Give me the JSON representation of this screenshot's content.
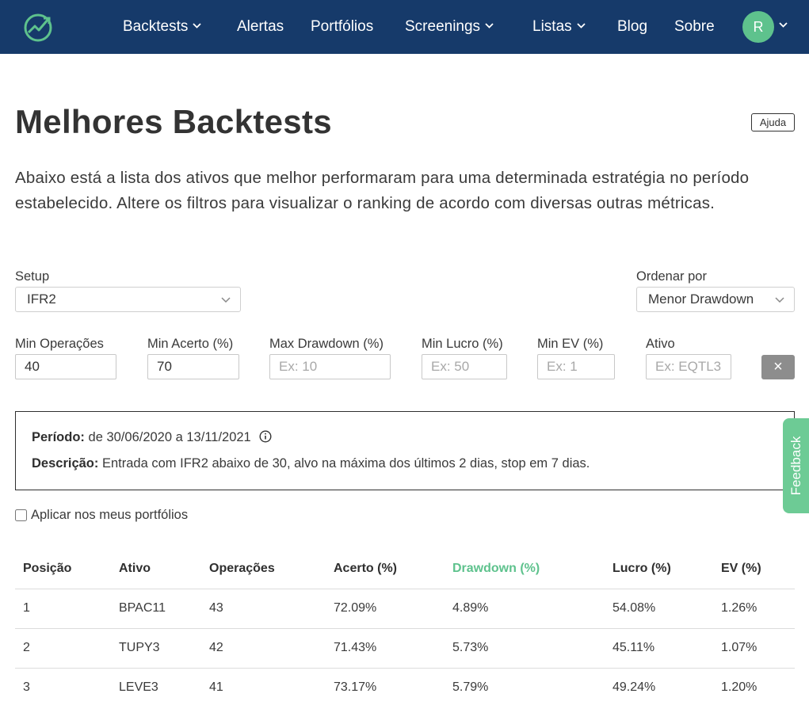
{
  "nav": {
    "items": [
      {
        "label": "Backtests",
        "dropdown": true
      },
      {
        "label": "Alertas",
        "dropdown": false
      },
      {
        "label": "Portfólios",
        "dropdown": false
      },
      {
        "label": "Screenings",
        "dropdown": true
      },
      {
        "label": "Listas",
        "dropdown": true
      },
      {
        "label": "Blog",
        "dropdown": false
      },
      {
        "label": "Sobre",
        "dropdown": false
      }
    ],
    "avatar_initial": "R"
  },
  "page": {
    "title": "Melhores Backtests",
    "help_label": "Ajuda",
    "intro": "Abaixo está a lista dos ativos que melhor performaram para uma determinada estratégia no período estabelecido. Altere os filtros para visualizar o ranking de acordo com diversas outras métricas."
  },
  "filters": {
    "setup_label": "Setup",
    "setup_value": "IFR2",
    "order_label": "Ordenar por",
    "order_value": "Menor Drawdown",
    "min_ops_label": "Min Operações",
    "min_ops_value": "40",
    "min_acerto_label": "Min Acerto (%)",
    "min_acerto_value": "70",
    "max_dd_label": "Max Drawdown (%)",
    "max_dd_placeholder": "Ex: 10",
    "min_lucro_label": "Min Lucro (%)",
    "min_lucro_placeholder": "Ex: 50",
    "min_ev_label": "Min EV (%)",
    "min_ev_placeholder": "Ex: 1",
    "ativo_label": "Ativo",
    "ativo_placeholder": "Ex: EQTL3",
    "clear_label": "×"
  },
  "info": {
    "periodo_label": "Período:",
    "periodo_value": "de 30/06/2020 a 13/11/2021",
    "descricao_label": "Descrição:",
    "descricao_value": "Entrada com IFR2 abaixo de 30, alvo na máxima dos últimos 2 dias, stop em 7 dias."
  },
  "feedback_label": "Feedback",
  "apply_label": "Aplicar nos meus portfólios",
  "table": {
    "headers": [
      "Posição",
      "Ativo",
      "Operações",
      "Acerto (%)",
      "Drawdown (%)",
      "Lucro (%)",
      "EV (%)"
    ],
    "rows": [
      [
        "1",
        "BPAC11",
        "43",
        "72.09%",
        "4.89%",
        "54.08%",
        "1.26%"
      ],
      [
        "2",
        "TUPY3",
        "42",
        "71.43%",
        "5.73%",
        "45.11%",
        "1.07%"
      ],
      [
        "3",
        "LEVE3",
        "41",
        "73.17%",
        "5.79%",
        "49.24%",
        "1.20%"
      ]
    ]
  },
  "colors": {
    "navbar": "#163a6a",
    "accent": "#5ec28d",
    "feedback": "#6dcb95"
  }
}
